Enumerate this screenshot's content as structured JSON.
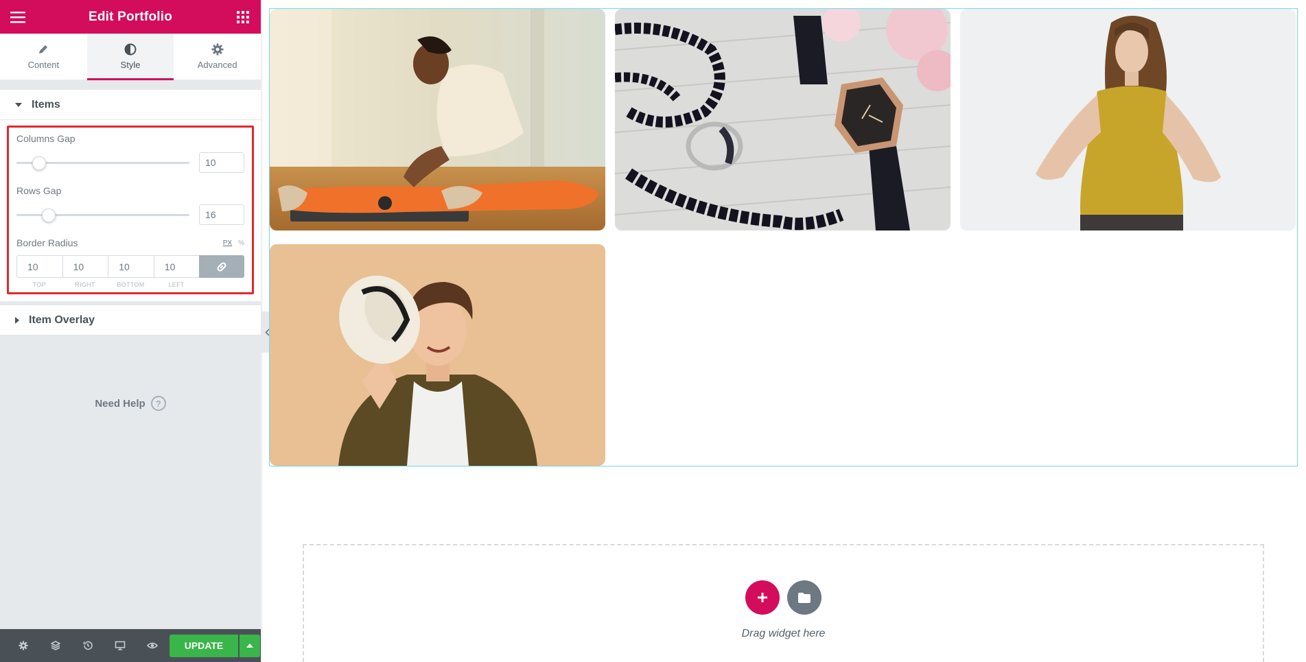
{
  "header": {
    "title": "Edit Portfolio",
    "menu_icon": "hamburger-icon",
    "apps_icon": "grid-icon"
  },
  "tabs": [
    {
      "label": "Content",
      "icon": "pencil-icon",
      "active": false
    },
    {
      "label": "Style",
      "icon": "contrast-icon",
      "active": true
    },
    {
      "label": "Advanced",
      "icon": "gear-icon",
      "active": false
    }
  ],
  "items_section": {
    "title": "Items",
    "columns_gap": {
      "label": "Columns Gap",
      "value": "10",
      "slider_fraction": 0.1
    },
    "rows_gap": {
      "label": "Rows Gap",
      "value": "16",
      "slider_fraction": 0.16
    },
    "border_radius": {
      "label": "Border Radius",
      "units": [
        "PX",
        "%"
      ],
      "active_unit": "PX",
      "values": [
        {
          "caption": "TOP",
          "value": "10"
        },
        {
          "caption": "RIGHT",
          "value": "10"
        },
        {
          "caption": "BOTTOM",
          "value": "10"
        },
        {
          "caption": "LEFT",
          "value": "10"
        }
      ],
      "link_icon": "link-icon"
    }
  },
  "overlay_section": {
    "title": "Item Overlay"
  },
  "help": {
    "label": "Need Help",
    "icon": "question-icon"
  },
  "footer": {
    "icons": [
      "settings-icon",
      "layers-icon",
      "history-icon",
      "responsive-icon",
      "preview-icon"
    ],
    "update_label": "UPDATE"
  },
  "canvas": {
    "portfolio_items": [
      "woman-stretching-photo",
      "jewelry-watch-photo",
      "woman-gold-dress-photo",
      "man-with-hat-photo"
    ],
    "drop_text": "Drag widget here"
  },
  "colors": {
    "brand": "#d30c5c",
    "update": "#39b54a",
    "highlight": "#e4262b",
    "selection": "#71d7f7"
  }
}
